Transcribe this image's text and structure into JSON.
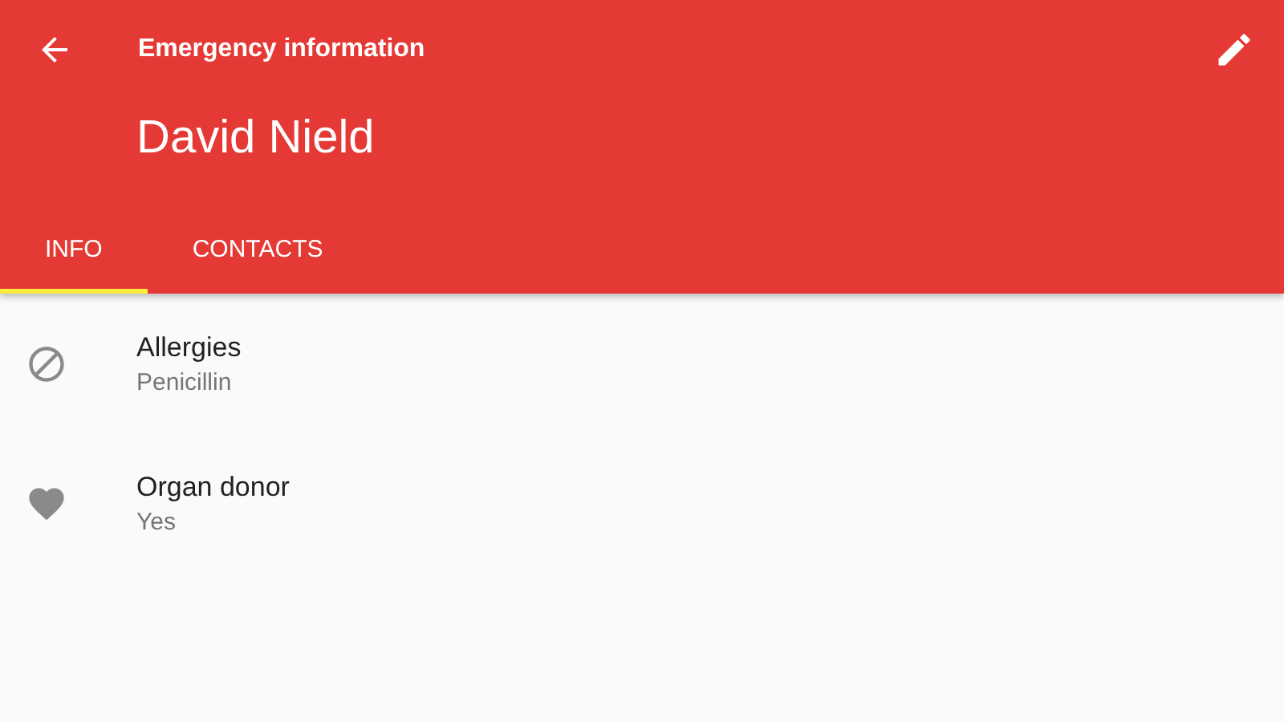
{
  "app_bar": {
    "title": "Emergency information",
    "name": "David Nield"
  },
  "tabs": [
    {
      "label": "INFO",
      "selected": true
    },
    {
      "label": "CONTACTS",
      "selected": false
    }
  ],
  "items": [
    {
      "kind": "allergies",
      "label": "Allergies",
      "value": "Penicillin"
    },
    {
      "kind": "organ_donor",
      "label": "Organ donor",
      "value": "Yes"
    }
  ]
}
